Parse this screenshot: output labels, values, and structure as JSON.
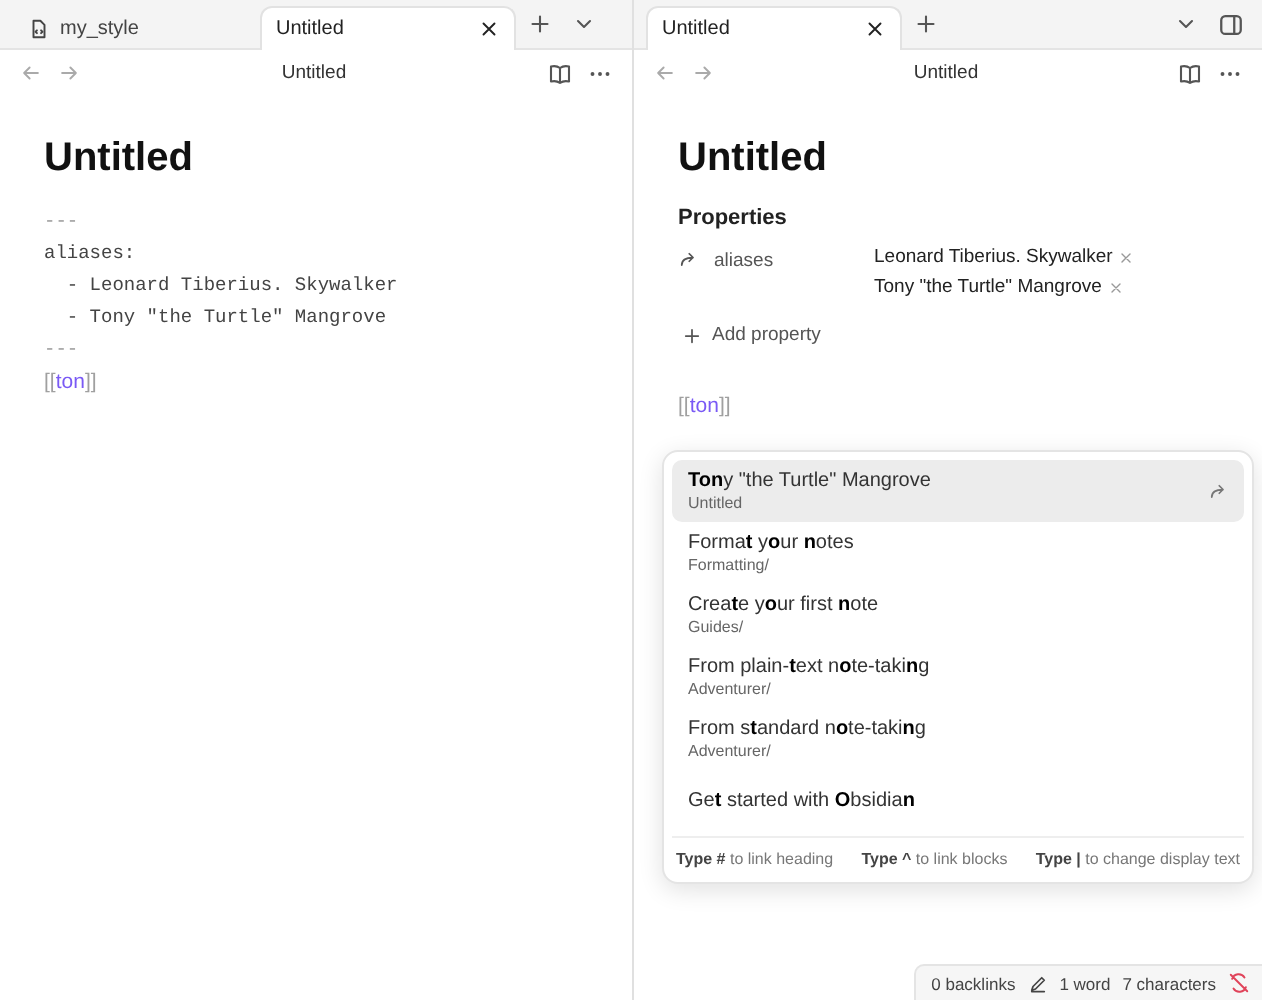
{
  "left_pane": {
    "tabs": [
      {
        "label": "my_style",
        "selected": false,
        "kind": "file"
      },
      {
        "label": "Untitled",
        "selected": true
      }
    ],
    "header_title": "Untitled",
    "note_title": "Untitled",
    "source_lines": [
      {
        "text": "---",
        "kind": "fence"
      },
      {
        "text": "aliases:",
        "kind": "key"
      },
      {
        "text": "  - Leonard Tiberius. Skywalker",
        "kind": "item"
      },
      {
        "text": "  - Tony \"the Turtle\" Mangrove",
        "kind": "item"
      },
      {
        "text": "---",
        "kind": "fence"
      }
    ],
    "link": {
      "open": "[[",
      "text": "ton",
      "close": "]]"
    }
  },
  "right_pane": {
    "tabs": [
      {
        "label": "Untitled",
        "selected": true
      }
    ],
    "header_title": "Untitled",
    "note_title": "Untitled",
    "properties": {
      "heading": "Properties",
      "items": [
        {
          "key": "aliases",
          "values": [
            "Leonard Tiberius. Skywalker",
            "Tony \"the Turtle\" Mangrove"
          ]
        }
      ],
      "add_label": "Add property"
    },
    "link": {
      "open": "[[",
      "text": "ton",
      "close": "]]"
    },
    "suggestions": [
      {
        "title": "**Ton**y \"the Turtle\" Mangrove",
        "path": "Untitled",
        "selected": true
      },
      {
        "title": "Forma**t** y**o**ur **n**otes",
        "path": "Formatting/",
        "selected": false
      },
      {
        "title": "Crea**t**e y**o**ur first **n**ote",
        "path": "Guides/",
        "selected": false
      },
      {
        "title": "From plain-**t**ext n**o**te-taki**n**g",
        "path": "Adventurer/",
        "selected": false
      },
      {
        "title": "From s**t**andard n**o**te-taki**n**g",
        "path": "Adventurer/",
        "selected": false
      },
      {
        "title": "Ge**t** started with **O**bsidia**n**",
        "selected": false
      }
    ],
    "hints": [
      "**Type #** to link heading",
      "**Type ^** to link blocks",
      "**Type |** to change display text"
    ],
    "status_bar": {
      "backlinks": "0 backlinks",
      "words": "1 word",
      "characters": "7 characters"
    }
  }
}
